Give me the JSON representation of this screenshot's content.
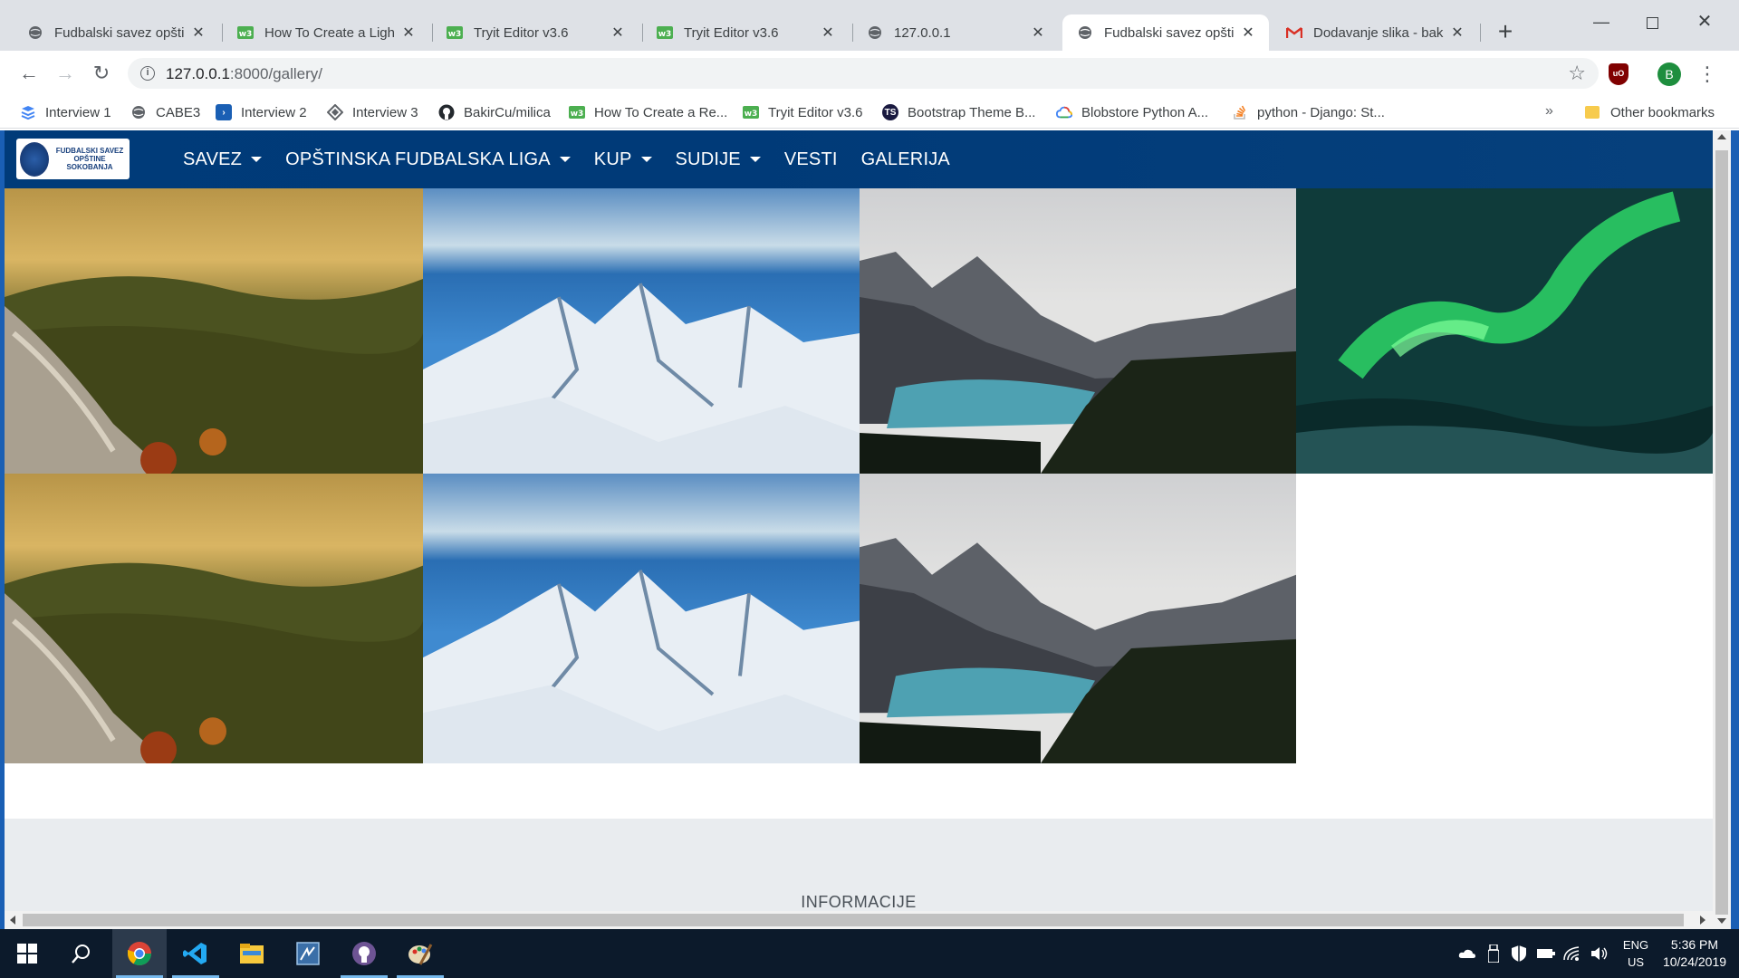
{
  "browser": {
    "tabs": [
      {
        "title": "Fudbalski savez opštine",
        "icon": "globe-icon",
        "active": false
      },
      {
        "title": "How To Create a Lightb",
        "icon": "tryit-icon",
        "active": false
      },
      {
        "title": "Tryit Editor v3.6",
        "icon": "tryit-icon",
        "active": false
      },
      {
        "title": "Tryit Editor v3.6",
        "icon": "tryit-icon",
        "active": false
      },
      {
        "title": "127.0.0.1",
        "icon": "globe-icon",
        "active": false
      },
      {
        "title": "Fudbalski savez opštin",
        "icon": "globe-icon",
        "active": true
      },
      {
        "title": "Dodavanje slika - bakir",
        "icon": "gmail-icon",
        "active": false
      }
    ],
    "url_host": "127.0.0.1",
    "url_path": ":8000/gallery/",
    "bookmarks": [
      {
        "label": "Interview 1",
        "icon": "docs-icon",
        "color": "#4285f4"
      },
      {
        "label": "CABE3",
        "icon": "globe-icon",
        "color": "#5f6368"
      },
      {
        "label": "Interview 2",
        "icon": "azure-icon",
        "color": "#0067b8"
      },
      {
        "label": "Interview 3",
        "icon": "diamond-icon",
        "color": "#5f6368"
      },
      {
        "label": "BakirCu/milica",
        "icon": "github-icon",
        "color": "#24292e"
      },
      {
        "label": "How To Create a Re...",
        "icon": "tryit-icon",
        "color": "#4caf50"
      },
      {
        "label": "Tryit Editor v3.6",
        "icon": "tryit-icon",
        "color": "#4caf50"
      },
      {
        "label": "Bootstrap Theme B...",
        "icon": "ts-icon",
        "color": "#1a1a40"
      },
      {
        "label": "Blobstore Python A...",
        "icon": "gcloud-icon",
        "color": "#4285f4"
      },
      {
        "label": "python - Django: St...",
        "icon": "stackoverflow-icon",
        "color": "#f48024"
      }
    ],
    "bookmark_overflow": "»",
    "other_bookmarks": "Other bookmarks",
    "avatar_letter": "B",
    "ublock_label": "uO"
  },
  "site": {
    "logo_text": "FUDBALSKI SAVEZ OPŠTINE SOKOBANJA",
    "nav": [
      {
        "label": "SAVEZ",
        "dropdown": true
      },
      {
        "label": "OPŠTINSKA FUDBALSKA LIGA",
        "dropdown": true
      },
      {
        "label": "KUP",
        "dropdown": true
      },
      {
        "label": "SUDIJE",
        "dropdown": true
      },
      {
        "label": "VESTI",
        "dropdown": false
      },
      {
        "label": "GALERIJA",
        "dropdown": false
      }
    ],
    "gallery": [
      {
        "scene": "autumn-forest-cliff"
      },
      {
        "scene": "snowy-mountains"
      },
      {
        "scene": "mountain-lake"
      },
      {
        "scene": "aurora"
      },
      {
        "scene": "autumn-forest-cliff"
      },
      {
        "scene": "snowy-mountains"
      },
      {
        "scene": "mountain-lake"
      }
    ],
    "footer_title": "INFORMACIJE"
  },
  "taskbar": {
    "apps": [
      {
        "name": "start-icon"
      },
      {
        "name": "search-icon"
      },
      {
        "name": "chrome-icon",
        "active": true
      },
      {
        "name": "vscode-icon"
      },
      {
        "name": "file-explorer-icon"
      },
      {
        "name": "app-icon"
      },
      {
        "name": "github-desktop-icon"
      },
      {
        "name": "paint-icon"
      }
    ],
    "lang_top": "ENG",
    "lang_bottom": "US",
    "time": "5:36 PM",
    "date": "10/24/2019"
  },
  "colors": {
    "site_nav": "#003b79",
    "taskbar": "#0c1a2b",
    "footer_bg": "#e9ecef"
  }
}
